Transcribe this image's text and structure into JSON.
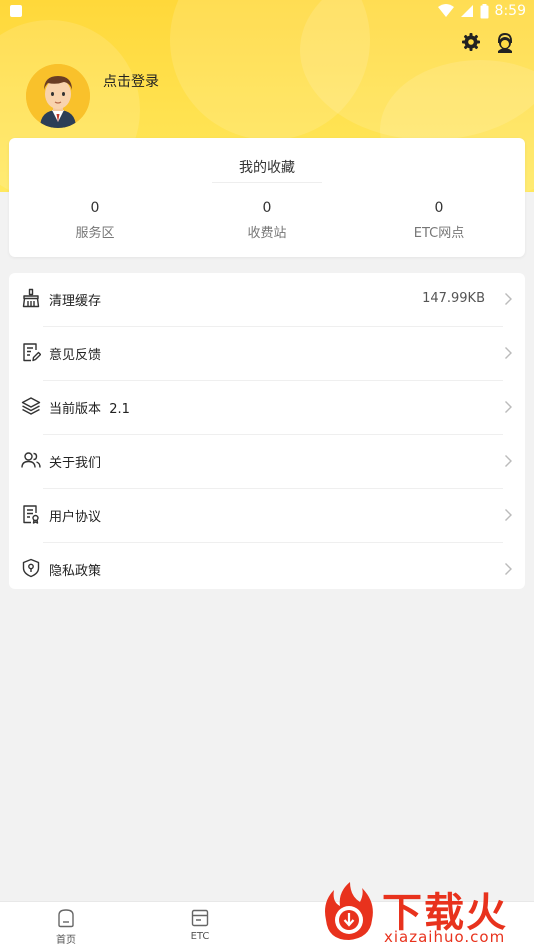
{
  "status_bar": {
    "time": "8:59"
  },
  "profile": {
    "login_text": "点击登录"
  },
  "favorites": {
    "title": "我的收藏",
    "items": [
      {
        "count": "0",
        "label": "服务区"
      },
      {
        "count": "0",
        "label": "收费站"
      },
      {
        "count": "0",
        "label": "ETC网点"
      }
    ]
  },
  "menu": {
    "items": [
      {
        "label": "清理缓存",
        "value": "147.99KB",
        "icon": "broom-icon"
      },
      {
        "label": "意见反馈",
        "value": "",
        "icon": "edit-document-icon"
      },
      {
        "label": "当前版本  2.1",
        "value": "",
        "icon": "layers-icon"
      },
      {
        "label": "关于我们",
        "value": "",
        "icon": "users-icon"
      },
      {
        "label": "用户协议",
        "value": "",
        "icon": "agreement-document-icon"
      },
      {
        "label": "隐私政策",
        "value": "",
        "icon": "shield-icon"
      }
    ]
  },
  "bottom_nav": {
    "items": [
      {
        "label": "首页",
        "icon": "home-icon"
      },
      {
        "label": "ETC",
        "icon": "card-icon"
      }
    ]
  },
  "watermark": {
    "title": "下载火",
    "subtitle": "xiazaihuo.com"
  },
  "colors": {
    "header": "#ffd83a",
    "accent": "#e8321d"
  }
}
